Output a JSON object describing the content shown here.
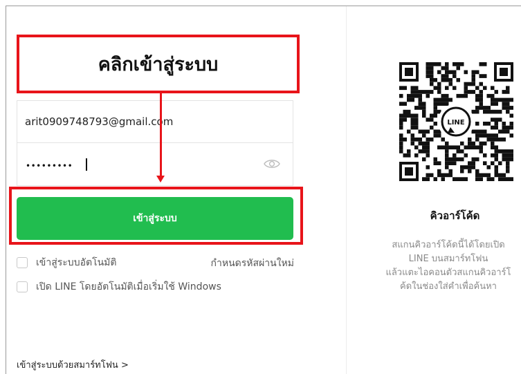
{
  "callout": {
    "text": "คลิกเข้าสู่ระบบ"
  },
  "login_form": {
    "email_value": "arit0909748793@gmail.com",
    "password_mask": "•••••••••",
    "login_button": "เข้าสู่ระบบ",
    "auto_login_label": "เข้าสู่ระบบอัตโนมัติ",
    "reset_password_link": "กำหนดรหัสผ่านใหม่",
    "start_with_windows_label": "เปิด LINE โดยอัตโนมัติเมื่อเริ่มใช้ Windows",
    "smartphone_login_link": "เข้าสู่ระบบด้วยสมาร์ทโฟน >"
  },
  "qr_panel": {
    "title": "คิวอาร์โค้ด",
    "description": "สแกนคิวอาร์โค้ดนี้ได้โดยเปิด\nLINE บนสมาร์ทโฟน\nแล้วแตะไอคอนตัวสแกนคิวอาร์โ\nค้ดในช่องใส่คำเพื่อค้นหา",
    "badge_text": "LINE"
  },
  "colors": {
    "accent_green": "#21bd4f",
    "annotation_red": "#e8141a"
  },
  "icons": {
    "password_toggle": "eye-icon",
    "qr_badge": "line-logo-icon"
  }
}
